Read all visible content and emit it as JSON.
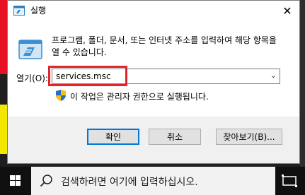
{
  "dialog": {
    "title": "실행",
    "description": "프로그램, 폴더, 문서, 또는 인터넷 주소를 입력하여 해당 항목을 열 수 있습니다.",
    "open_label": "열기(O):",
    "open_value": "services.msc",
    "admin_note": "이 작업은 관리자 권한으로 실행됩니다.",
    "buttons": {
      "ok": "확인",
      "cancel": "취소",
      "browse": "찾아보기(B)..."
    }
  },
  "taskbar": {
    "search_placeholder": "검색하려면 여기에 입력하십시오."
  },
  "colors": {
    "highlight": "#e0262d",
    "accent": "#0078d7"
  }
}
